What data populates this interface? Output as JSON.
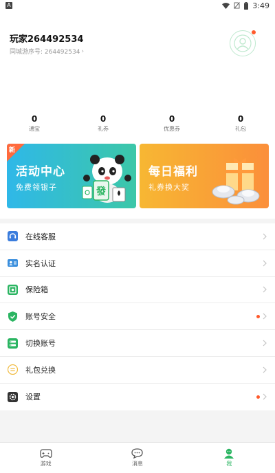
{
  "statusbar": {
    "app_badge": "A",
    "time": "3:49",
    "icons": [
      "wifi-icon",
      "no-sim-icon",
      "battery-icon"
    ]
  },
  "profile": {
    "name": "玩家264492534",
    "id_line": "同城游序号: 264492534",
    "avatar_icon": "user-avatar-icon",
    "has_notification_dot": true
  },
  "stats": [
    {
      "value": "0",
      "label": "通宝"
    },
    {
      "value": "0",
      "label": "礼券"
    },
    {
      "value": "0",
      "label": "优惠券"
    },
    {
      "value": "0",
      "label": "礼包"
    }
  ],
  "banners": {
    "left": {
      "tag": "新",
      "title": "活动中心",
      "subtitle": "免费领银子",
      "color_start": "#2fb8e8",
      "color_end": "#3cc7a8"
    },
    "right": {
      "title": "每日福利",
      "subtitle": "礼券换大奖",
      "color_start": "#f7b733",
      "color_end": "#fb8f3a"
    }
  },
  "menu": [
    {
      "label": "在线客服",
      "icon": "customer-service-icon",
      "color": "#3b7ddd",
      "dot": false
    },
    {
      "label": "实名认证",
      "icon": "id-card-icon",
      "color": "#3b8fdd",
      "dot": false
    },
    {
      "label": "保险箱",
      "icon": "safe-box-icon",
      "color": "#2bb562",
      "dot": false
    },
    {
      "label": "账号安全",
      "icon": "shield-icon",
      "color": "#2bb562",
      "dot": true
    },
    {
      "label": "切换账号",
      "icon": "switch-account-icon",
      "color": "#2bb562",
      "dot": false
    },
    {
      "label": "礼包兑换",
      "icon": "gift-exchange-icon",
      "color": "#f0b93a",
      "dot": false
    },
    {
      "label": "设置",
      "icon": "gear-icon",
      "color": "#333333",
      "dot": true
    }
  ],
  "tabbar": {
    "tabs": [
      {
        "label": "游戏",
        "icon": "gamepad-icon",
        "active": false
      },
      {
        "label": "消息",
        "icon": "message-icon",
        "active": false
      },
      {
        "label": "我",
        "icon": "person-icon",
        "active": true
      }
    ],
    "active_color": "#2bb562"
  }
}
